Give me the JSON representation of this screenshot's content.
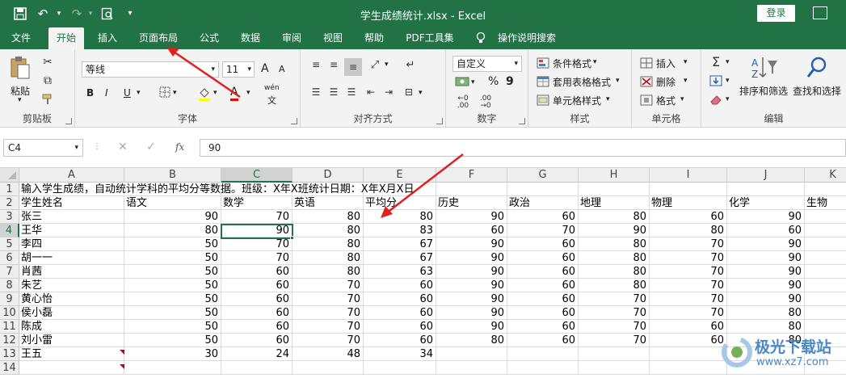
{
  "window": {
    "title": "学生成绩统计.xlsx  -  Excel",
    "login_label": "登录"
  },
  "quick_access": [
    "save-icon",
    "undo-icon",
    "redo-icon",
    "print-preview-icon",
    "customize-icon"
  ],
  "tabs": [
    {
      "label": "文件"
    },
    {
      "label": "开始"
    },
    {
      "label": "插入"
    },
    {
      "label": "页面布局"
    },
    {
      "label": "公式"
    },
    {
      "label": "数据"
    },
    {
      "label": "审阅"
    },
    {
      "label": "视图"
    },
    {
      "label": "帮助"
    },
    {
      "label": "PDF工具集"
    },
    {
      "label": "操作说明搜索"
    }
  ],
  "ribbon": {
    "clipboard": {
      "paste": "粘贴",
      "label": "剪贴板"
    },
    "font": {
      "name": "等线",
      "size": "11",
      "label": "字体",
      "grow": "A",
      "shrink": "A",
      "bold": "B",
      "italic": "I",
      "underline": "U",
      "font_color": "A",
      "phonetic": "wén"
    },
    "alignment": {
      "label": "对齐方式"
    },
    "number": {
      "format": "自定义",
      "percent": "%",
      "comma": "9",
      "label": "数字"
    },
    "styles": {
      "conditional": "条件格式",
      "table": "套用表格格式",
      "cell": "单元格样式",
      "label": "样式"
    },
    "cells": {
      "insert": "插入",
      "delete": "删除",
      "format": "格式",
      "label": "单元格"
    },
    "editing": {
      "sort": "排序和筛选",
      "find": "查找和选择",
      "label": "编辑"
    }
  },
  "formula_bar": {
    "name_box": "C4",
    "fx": "fx",
    "value": "90"
  },
  "sheet": {
    "columns": [
      "A",
      "B",
      "C",
      "D",
      "E",
      "F",
      "G",
      "H",
      "I",
      "J",
      "K"
    ],
    "selected_column": "C",
    "selected_row": "4",
    "rows": [
      {
        "n": "1",
        "cells": [
          "输入学生成绩，自动统计学科的平均分等数据。班级：X年X班统计日期：X年X月X日",
          "",
          "",
          "",
          "",
          "",
          "",
          "",
          "",
          "",
          ""
        ]
      },
      {
        "n": "2",
        "cells": [
          "学生姓名",
          "语文",
          "数学",
          "英语",
          "平均分",
          "历史",
          "政治",
          "地理",
          "物理",
          "化学",
          "生物"
        ]
      },
      {
        "n": "3",
        "cells": [
          "张三",
          "90",
          "70",
          "80",
          "80",
          "90",
          "60",
          "80",
          "60",
          "90",
          ""
        ]
      },
      {
        "n": "4",
        "cells": [
          "王华",
          "80",
          "90",
          "80",
          "83",
          "60",
          "70",
          "90",
          "80",
          "60",
          ""
        ]
      },
      {
        "n": "5",
        "cells": [
          "李四",
          "50",
          "70",
          "80",
          "67",
          "90",
          "60",
          "80",
          "70",
          "90",
          ""
        ]
      },
      {
        "n": "6",
        "cells": [
          "胡一一",
          "50",
          "70",
          "80",
          "67",
          "90",
          "60",
          "80",
          "70",
          "90",
          ""
        ]
      },
      {
        "n": "7",
        "cells": [
          "肖茜",
          "50",
          "60",
          "80",
          "63",
          "90",
          "60",
          "80",
          "70",
          "90",
          ""
        ]
      },
      {
        "n": "8",
        "cells": [
          "朱艺",
          "50",
          "60",
          "70",
          "60",
          "90",
          "60",
          "80",
          "70",
          "90",
          ""
        ]
      },
      {
        "n": "9",
        "cells": [
          "黄心怡",
          "50",
          "60",
          "70",
          "60",
          "90",
          "60",
          "70",
          "70",
          "90",
          ""
        ]
      },
      {
        "n": "10",
        "cells": [
          "侯小磊",
          "50",
          "60",
          "70",
          "60",
          "90",
          "60",
          "70",
          "70",
          "80",
          ""
        ]
      },
      {
        "n": "11",
        "cells": [
          "陈成",
          "50",
          "60",
          "70",
          "60",
          "90",
          "60",
          "70",
          "60",
          "80",
          ""
        ]
      },
      {
        "n": "12",
        "cells": [
          "刘小雷",
          "50",
          "60",
          "70",
          "60",
          "80",
          "60",
          "70",
          "60",
          "80",
          ""
        ]
      },
      {
        "n": "13",
        "cells": [
          "王五",
          "30",
          "24",
          "48",
          "34",
          "",
          "",
          "",
          "",
          "",
          ""
        ]
      },
      {
        "n": "14",
        "cells": [
          "",
          "",
          "",
          "",
          "",
          "",
          "",
          "",
          "",
          "",
          ""
        ]
      }
    ]
  },
  "watermark": {
    "brand": "极光下载站",
    "url": "www.xz7.com"
  },
  "accent": "#217346",
  "arrow_color": "#e02020"
}
